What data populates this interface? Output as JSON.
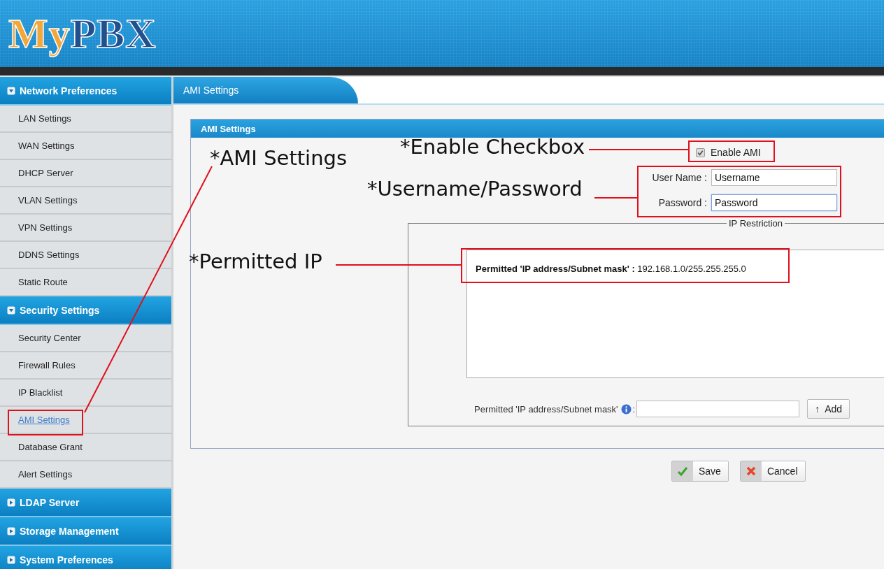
{
  "logo": {
    "first": "My",
    "second": "PBX"
  },
  "sidebar": [
    {
      "label": "Network Preferences",
      "expanded": true,
      "children": [
        {
          "label": "LAN Settings",
          "selected": false
        },
        {
          "label": "WAN Settings",
          "selected": false
        },
        {
          "label": "DHCP Server",
          "selected": false
        },
        {
          "label": "VLAN Settings",
          "selected": false
        },
        {
          "label": "VPN Settings",
          "selected": false
        },
        {
          "label": "DDNS Settings",
          "selected": false
        },
        {
          "label": "Static Route",
          "selected": false
        }
      ]
    },
    {
      "label": "Security Settings",
      "expanded": true,
      "children": [
        {
          "label": "Security Center",
          "selected": false
        },
        {
          "label": "Firewall Rules",
          "selected": false
        },
        {
          "label": "IP Blacklist",
          "selected": false
        },
        {
          "label": "AMI Settings",
          "selected": true
        },
        {
          "label": "Database Grant",
          "selected": false
        },
        {
          "label": "Alert Settings",
          "selected": false
        }
      ]
    },
    {
      "label": "LDAP Server",
      "expanded": false
    },
    {
      "label": "Storage Management",
      "expanded": false
    },
    {
      "label": "System Preferences",
      "expanded": false
    }
  ],
  "tabs": [
    {
      "label": "AMI Settings",
      "selected": true
    }
  ],
  "panel": {
    "title": "AMI Settings",
    "enable": {
      "label": "Enable AMI",
      "checked": true
    },
    "fields": [
      {
        "label": "User Name :",
        "value": "Username",
        "focused": false
      },
      {
        "label": "Password :",
        "value": "Password",
        "focused": true
      }
    ],
    "ip_restriction": {
      "legend": "IP Restriction",
      "entries": [
        "**Permitted 'IP address/Subnet mask' :** 192.168.1.0/255.255.255.0"
      ],
      "add_label": "Permitted 'IP address/Subnet mask'",
      "add_colon": ":",
      "add_button": "↑  Add"
    }
  },
  "buttons": [
    {
      "label": "Save",
      "kind": "save"
    },
    {
      "label": "Cancel",
      "kind": "cancel"
    }
  ],
  "annotations": [
    {
      "text": "*AMI Settings"
    },
    {
      "text": "*Enable Checkbox"
    },
    {
      "text": "*Username/Password"
    },
    {
      "text": "*Permitted IP"
    }
  ]
}
